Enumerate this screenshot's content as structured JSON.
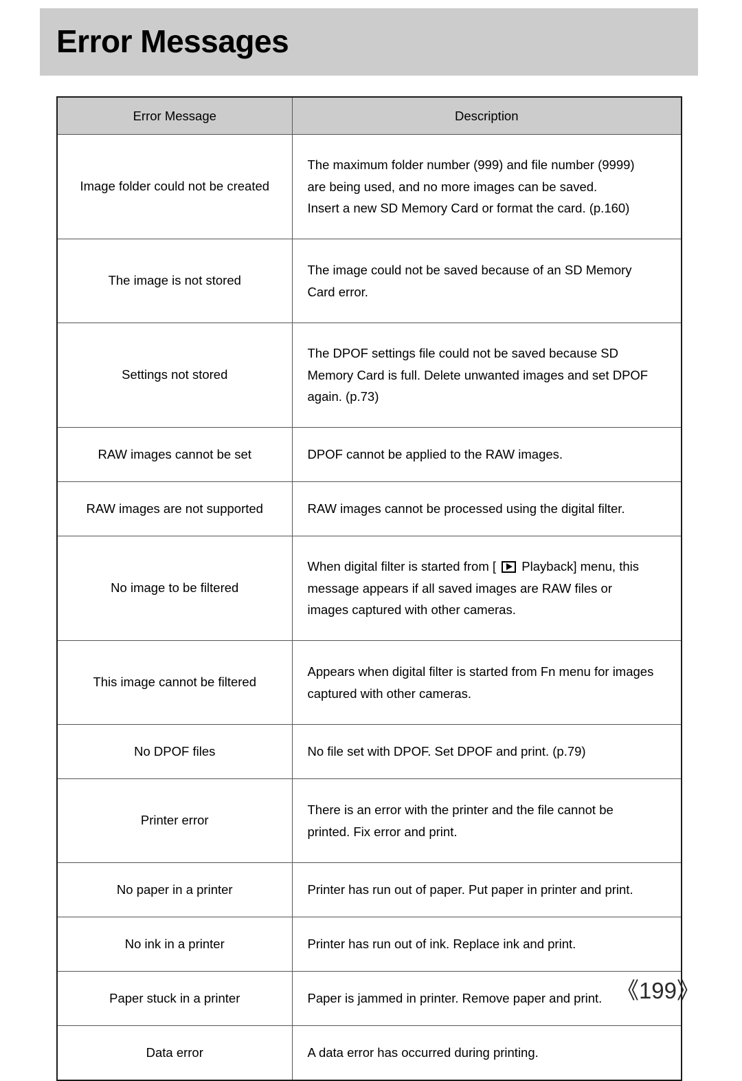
{
  "header": {
    "title": "Error Messages"
  },
  "table": {
    "columns": [
      "Error Message",
      "Description"
    ],
    "rows": [
      {
        "message": "Image folder could not be created",
        "lines": [
          "The maximum folder number (999) and file number (9999)",
          "are being used, and no more images can be saved.",
          "Insert a new SD Memory Card or format the card. (p.160)"
        ]
      },
      {
        "message": "The image is not stored",
        "lines": [
          "The image could not be saved because of an SD Memory",
          "Card error."
        ]
      },
      {
        "message": "Settings not stored",
        "lines": [
          "The DPOF settings file could not be saved because SD",
          "Memory Card is full. Delete unwanted images and set DPOF",
          "again. (p.73)"
        ]
      },
      {
        "message": "RAW images cannot be set",
        "lines": [
          "DPOF cannot be applied to the RAW images."
        ]
      },
      {
        "message": "RAW images are not supported",
        "lines": [
          "RAW images cannot be processed using the digital filter."
        ]
      },
      {
        "message": "No image to be filtered",
        "lines": [
          "When digital filter is started from [ ",
          " Playback] menu, this",
          "message appears if all saved images are RAW files or",
          "images captured with other cameras."
        ],
        "icon": "playback-icon"
      },
      {
        "message": "This image cannot be filtered",
        "lines": [
          "Appears when digital filter is started from Fn menu for images",
          "captured with other cameras."
        ]
      },
      {
        "message": "No DPOF files",
        "lines": [
          "No file set with DPOF. Set DPOF and print. (p.79)"
        ]
      },
      {
        "message": "Printer error",
        "lines": [
          "There is an error with the printer and the file cannot be",
          "printed. Fix error and print."
        ]
      },
      {
        "message": "No paper in a printer",
        "lines": [
          "Printer has run out of paper. Put paper in printer and print."
        ]
      },
      {
        "message": "No ink in a printer",
        "lines": [
          "Printer has run out of ink. Replace ink and print."
        ]
      },
      {
        "message": "Paper stuck in a printer",
        "lines": [
          "Paper is jammed in printer. Remove paper and print."
        ]
      },
      {
        "message": "Data error",
        "lines": [
          "A data error has occurred during printing."
        ]
      }
    ]
  },
  "footer": {
    "page_number": "《199》"
  },
  "colors": {
    "banner_gray": "#cccccc",
    "header_row_gray": "#cccccc",
    "text_black": "#000000",
    "border_dark": "#1a1a1a",
    "border_light": "#555555"
  }
}
